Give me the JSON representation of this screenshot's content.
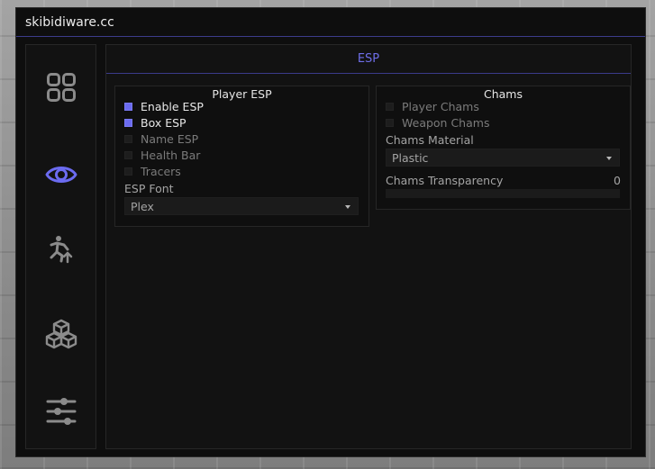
{
  "window": {
    "title": "skibidiware.cc"
  },
  "sidebar": {
    "items": [
      {
        "icon": "grid-icon",
        "active": false
      },
      {
        "icon": "eye-icon",
        "active": true
      },
      {
        "icon": "running-person-icon",
        "active": false
      },
      {
        "icon": "cubes-icon",
        "active": false
      },
      {
        "icon": "sliders-icon",
        "active": false
      }
    ]
  },
  "main": {
    "tab_title": "ESP",
    "player_esp": {
      "title": "Player ESP",
      "toggles": [
        {
          "label": "Enable ESP",
          "checked": true
        },
        {
          "label": "Box ESP",
          "checked": true
        },
        {
          "label": "Name ESP",
          "checked": false
        },
        {
          "label": "Health Bar",
          "checked": false
        },
        {
          "label": "Tracers",
          "checked": false
        }
      ],
      "font_label": "ESP Font",
      "font_value": "Plex"
    },
    "chams": {
      "title": "Chams",
      "toggles": [
        {
          "label": "Player Chams",
          "checked": false
        },
        {
          "label": "Weapon Chams",
          "checked": false
        }
      ],
      "material_label": "Chams Material",
      "material_value": "Plastic",
      "transparency_label": "Chams Transparency",
      "transparency_value": "0",
      "transparency_fraction": 0
    }
  },
  "colors": {
    "accent": "#6b6bf0",
    "window_bg": "#0e0e0e",
    "panel_bg": "#121212",
    "text_on": "#e8e8e8",
    "text_off": "#7b7b7b"
  }
}
